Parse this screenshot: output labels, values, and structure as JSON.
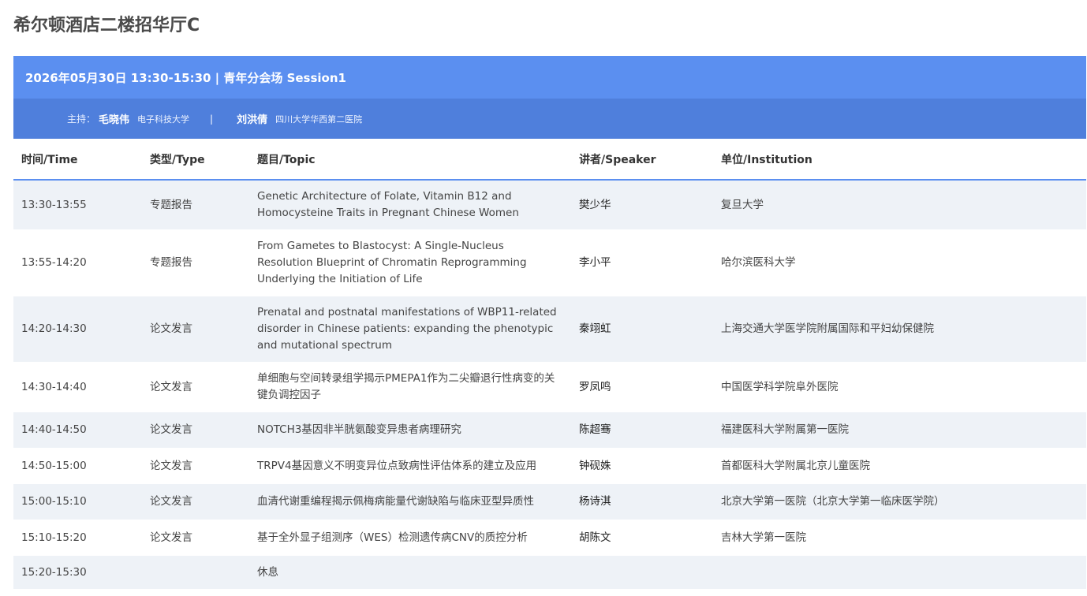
{
  "venue": "希尔顿酒店二楼招华厅C",
  "session": {
    "header": "2026年05月30日 13:30-15:30 | 青年分会场 Session1",
    "chair_label": "主持：",
    "chairs": [
      {
        "name": "毛晓伟",
        "institution": "电子科技大学"
      },
      {
        "name": "刘洪倩",
        "institution": "四川大学华西第二医院"
      }
    ],
    "separator": "|"
  },
  "table": {
    "headers": [
      "时间/Time",
      "类型/Type",
      "题目/Topic",
      "讲者/Speaker",
      "单位/Institution"
    ],
    "rows": [
      {
        "time": "13:30-13:55",
        "type": "专题报告",
        "topic": "Genetic Architecture of Folate, Vitamin B12 and Homocysteine Traits in Pregnant Chinese Women",
        "speaker": "樊少华",
        "institution": "复旦大学"
      },
      {
        "time": "13:55-14:20",
        "type": "专题报告",
        "topic": "From Gametes to Blastocyst: A Single-Nucleus Resolution Blueprint of Chromatin Reprogramming Underlying the Initiation of Life",
        "speaker": "李小平",
        "institution": "哈尔滨医科大学"
      },
      {
        "time": "14:20-14:30",
        "type": "论文发言",
        "topic": "Prenatal and postnatal manifestations of WBP11-related disorder in Chinese patients: expanding the phenotypic and mutational spectrum",
        "speaker": "秦翊虹",
        "institution": "上海交通大学医学院附属国际和平妇幼保健院"
      },
      {
        "time": "14:30-14:40",
        "type": "论文发言",
        "topic": "单细胞与空间转录组学揭示PMEPA1作为二尖瓣退行性病变的关键负调控因子",
        "speaker": "罗凤鸣",
        "institution": "中国医学科学院阜外医院"
      },
      {
        "time": "14:40-14:50",
        "type": "论文发言",
        "topic": "NOTCH3基因非半胱氨酸变异患者病理研究",
        "speaker": "陈超骞",
        "institution": "福建医科大学附属第一医院"
      },
      {
        "time": "14:50-15:00",
        "type": "论文发言",
        "topic": "TRPV4基因意义不明变异位点致病性评估体系的建立及应用",
        "speaker": "钟砚姝",
        "institution": "首都医科大学附属北京儿童医院"
      },
      {
        "time": "15:00-15:10",
        "type": "论文发言",
        "topic": "血清代谢重编程揭示佩梅病能量代谢缺陷与临床亚型异质性",
        "speaker": "杨诗淇",
        "institution": "北京大学第一医院（北京大学第一临床医学院）"
      },
      {
        "time": "15:10-15:20",
        "type": "论文发言",
        "topic": "基于全外显子组测序（WES）检测遗传病CNV的质控分析",
        "speaker": "胡陈文",
        "institution": "吉林大学第一医院"
      },
      {
        "time": "15:20-15:30",
        "type": "",
        "topic": "休息",
        "speaker": "",
        "institution": ""
      }
    ]
  }
}
